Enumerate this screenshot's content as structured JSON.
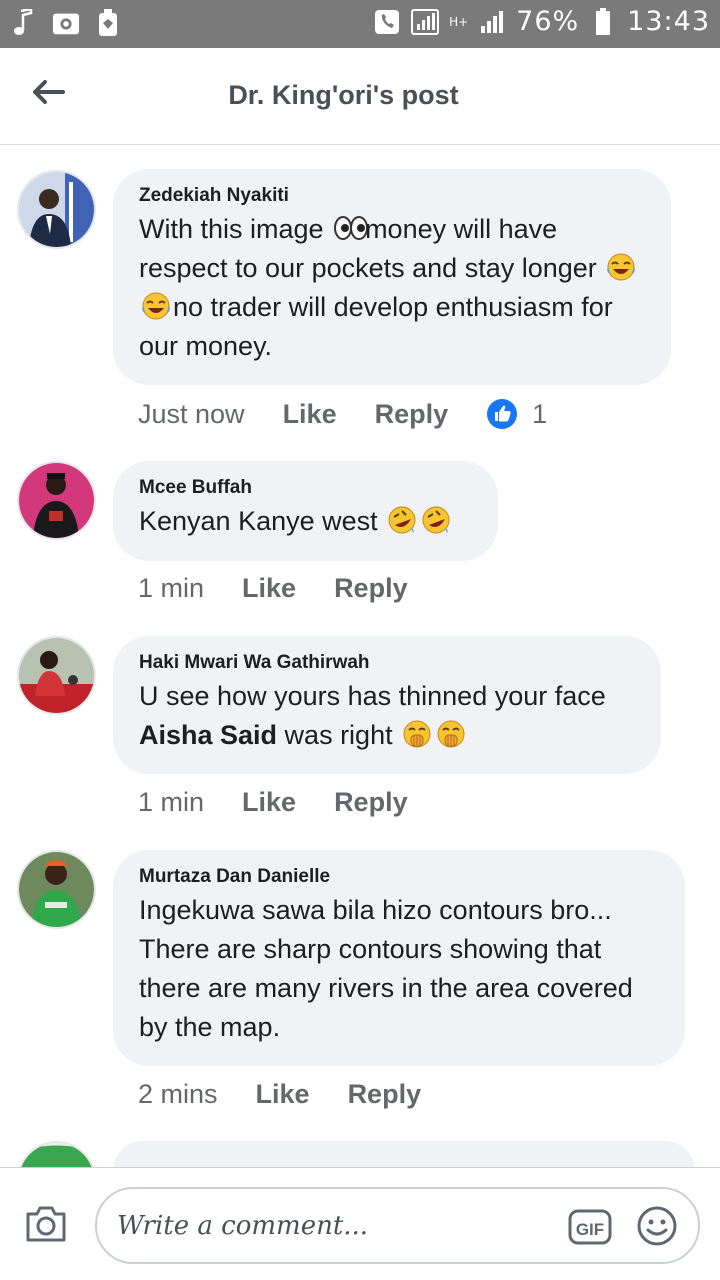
{
  "status_bar": {
    "battery": "76%",
    "time": "13:43",
    "network": "H+"
  },
  "header": {
    "title": "Dr. King'ori's post"
  },
  "comments": [
    {
      "author": "Zedekiah Nyakiti",
      "text_part1": "With this image ",
      "text_part2": "money will have respect to our pockets and stay longer ",
      "text_part3": "no trader will develop enthusiasm for our money.",
      "time": "Just now",
      "like_label": "Like",
      "reply_label": "Reply",
      "reaction_count": "1"
    },
    {
      "author": "Mcee Buffah",
      "text": "Kenyan Kanye west ",
      "time": "1 min",
      "like_label": "Like",
      "reply_label": "Reply"
    },
    {
      "author": "Haki Mwari Wa Gathirwah",
      "text_part1": "U see how yours has thinned your face ",
      "mention": "Aisha Said",
      "text_part2": "  was right ",
      "time": "1 min",
      "like_label": "Like",
      "reply_label": "Reply"
    },
    {
      "author": "Murtaza Dan Danielle",
      "text": "Ingekuwa sawa bila hizo contours bro... There are sharp contours showing that there are many rivers in the area covered by the map.",
      "time": "2 mins",
      "like_label": "Like",
      "reply_label": "Reply"
    }
  ],
  "composer": {
    "placeholder": "Write a comment...",
    "gif_label": "GIF"
  },
  "colors": {
    "accent": "#1877f2",
    "bubble": "#f0f2f5",
    "status_bar": "#7a7a7a"
  }
}
